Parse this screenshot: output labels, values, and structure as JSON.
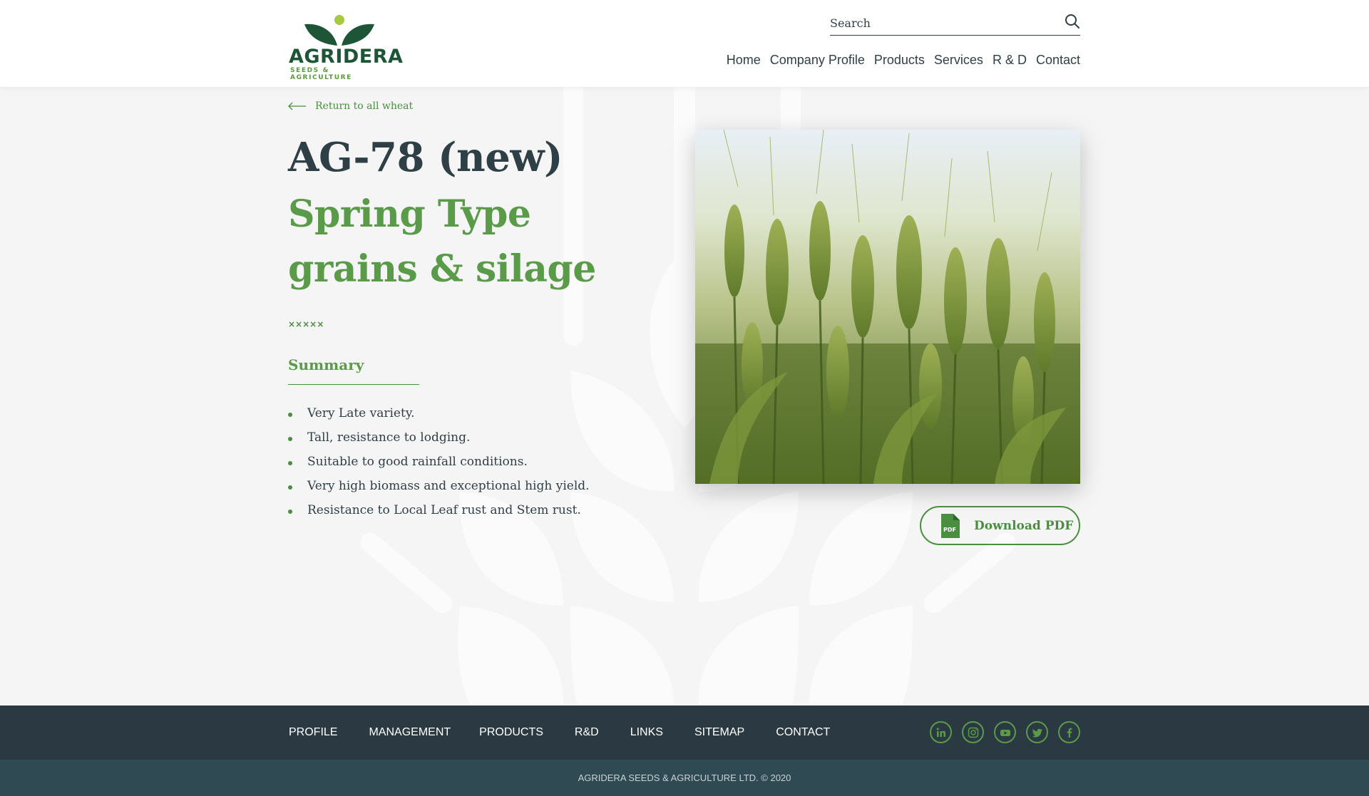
{
  "brand": {
    "name": "AGRIDERA",
    "tagline": "SEEDS & AGRICULTURE",
    "primary_color": "#1f5537",
    "accent_color": "#5a9b4a",
    "dot_color": "#a6c93f"
  },
  "search": {
    "placeholder": "Search",
    "icon": "search-icon"
  },
  "nav": {
    "items": [
      {
        "label": "Home"
      },
      {
        "label": "Company Profile"
      },
      {
        "label": "Products"
      },
      {
        "label": "Services"
      },
      {
        "label": "R & D"
      },
      {
        "label": "Contact"
      }
    ]
  },
  "product": {
    "back_link": "Return to all wheat",
    "title": "AG-78 (new)",
    "subtitle": "Spring Type grains & silage",
    "stars": "×××××",
    "summary_heading": "Summary",
    "summary": [
      "Very Late variety.",
      "Tall, resistance to lodging.",
      "Suitable to good rainfall conditions.",
      "Very high biomass and exceptional high yield.",
      "Resistance to Local Leaf rust and Stem rust."
    ],
    "download_label": "Download PDF",
    "pdf_icon_text": "PDF"
  },
  "footer": {
    "links": [
      {
        "label": "PROFILE"
      },
      {
        "label": "MANAGEMENT"
      },
      {
        "label": "PRODUCTS"
      },
      {
        "label": "R&D"
      },
      {
        "label": "LINKS"
      },
      {
        "label": "SITEMAP"
      },
      {
        "label": "CONTACT"
      }
    ],
    "social": [
      "linkedin-icon",
      "instagram-icon",
      "youtube-icon",
      "twitter-icon",
      "facebook-icon"
    ],
    "copyright": "AGRIDERA SEEDS & AGRICULTURE LTD. © 2020"
  }
}
